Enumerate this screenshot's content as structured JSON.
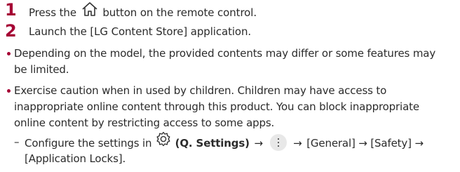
{
  "steps": [
    {
      "number": "1",
      "before": "Press the",
      "after": "button on the remote control.",
      "icon": "home-icon"
    },
    {
      "number": "2",
      "text": "Launch the [LG Content Store] application."
    }
  ],
  "notes": [
    {
      "lines": [
        "Depending on the model, the provided contents may differ or some features may",
        "be limited."
      ]
    },
    {
      "lines": [
        "Exercise caution when in used by children. Children may have access to",
        "inappropriate online content through this product. You can block inappropriate",
        "online content by restricting access to some apps."
      ]
    }
  ],
  "sub_note": {
    "dash": "–",
    "before": "Configure the settings in",
    "settings_label": "(Q. Settings)",
    "arrow": "→",
    "tail": "[General] → [Safety] →",
    "line2": "[Application Locks].",
    "icons": [
      "gear-icon",
      "more-menu-icon"
    ]
  },
  "colors": {
    "accent": "#a50034",
    "text": "#2b2b2b",
    "icon_bg": "#e8e8e8"
  }
}
